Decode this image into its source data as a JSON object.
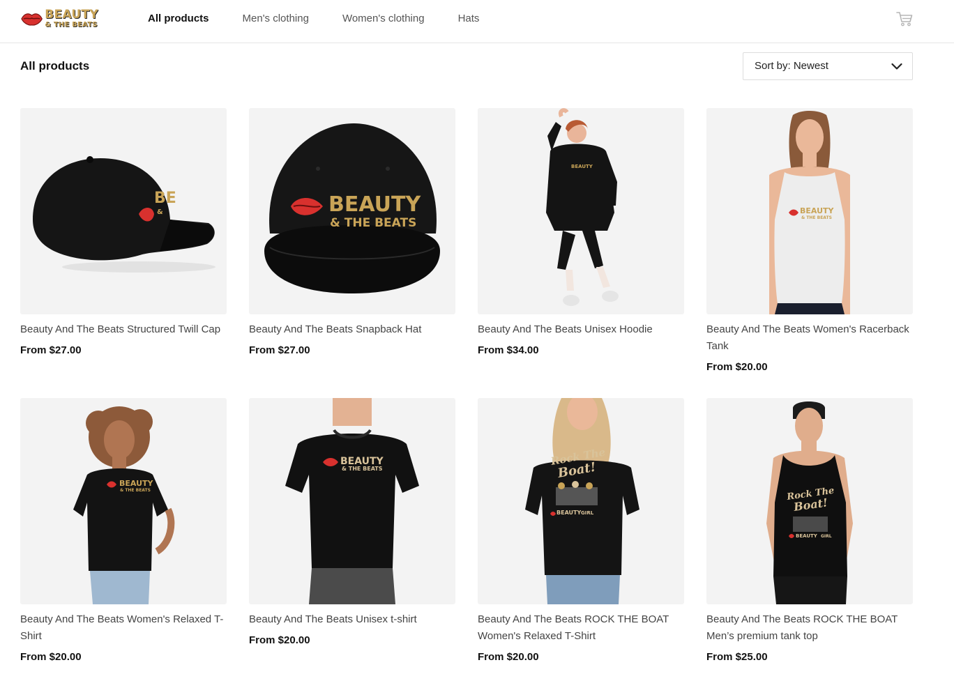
{
  "brand": {
    "name_line1": "BEAUTY",
    "name_line2": "& THE BEATS"
  },
  "nav": {
    "items": [
      {
        "label": "All products",
        "active": true
      },
      {
        "label": "Men's clothing",
        "active": false
      },
      {
        "label": "Women's clothing",
        "active": false
      },
      {
        "label": "Hats",
        "active": false
      }
    ],
    "cart_icon": "cart-icon"
  },
  "page": {
    "title": "All products",
    "sort_label": "Sort by: Newest"
  },
  "products": [
    {
      "name": "Beauty And The Beats Structured Twill Cap",
      "price": "From $27.00",
      "image": "black-cap-side"
    },
    {
      "name": "Beauty And The Beats Snapback Hat",
      "price": "From $27.00",
      "image": "black-snapback-front"
    },
    {
      "name": "Beauty And The Beats Unisex Hoodie",
      "price": "From $34.00",
      "image": "woman-black-hoodie"
    },
    {
      "name": "Beauty And The Beats Women's Racerback Tank",
      "price": "From $20.00",
      "image": "woman-white-tank"
    },
    {
      "name": "Beauty And The Beats Women's Relaxed T-Shirt",
      "price": "From $20.00",
      "image": "woman-black-tshirt"
    },
    {
      "name": "Beauty And The Beats Unisex t-shirt",
      "price": "From $20.00",
      "image": "man-black-tshirt"
    },
    {
      "name": "Beauty And The Beats ROCK THE BOAT Women's Relaxed T-Shirt",
      "price": "From $20.00",
      "image": "woman-rock-the-boat-tshirt"
    },
    {
      "name": "Beauty And The Beats ROCK THE BOAT Men’s premium tank top",
      "price": "From $25.00",
      "image": "man-rock-the-boat-tank"
    }
  ],
  "colors": {
    "accent_gold": "#c9a457",
    "lips_red": "#d8312e",
    "thumb_bg": "#f3f3f3"
  }
}
